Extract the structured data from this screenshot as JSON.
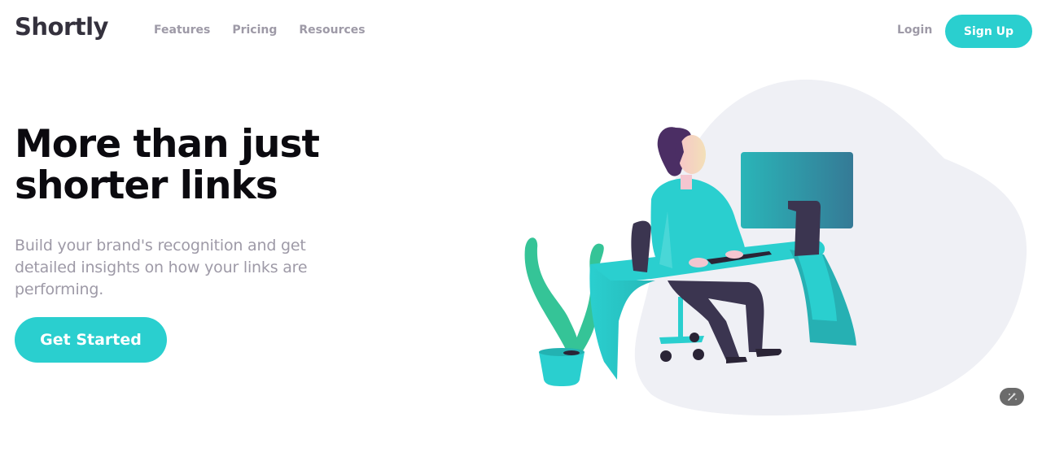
{
  "brand": {
    "name": "Shortly",
    "accent": "#2acfcf",
    "dark": "#34313d",
    "muted": "#9e9aa7"
  },
  "nav": {
    "items": [
      "Features",
      "Pricing",
      "Resources"
    ]
  },
  "auth": {
    "login": "Login",
    "signup": "Sign Up"
  },
  "hero": {
    "title_line1": "More than just",
    "title_line2": "shorter links",
    "subtitle": "Build your brand's recognition and get detailed insights on how your links are performing.",
    "cta": "Get Started"
  },
  "illustration": {
    "name": "person-working-illustration"
  },
  "widget": {
    "icon": "magic-wand-icon"
  }
}
